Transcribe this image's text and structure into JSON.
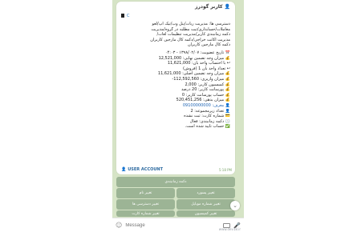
{
  "bubble": {
    "title": "کاربر گودرز",
    "phone_code": "C",
    "lines": [
      "دسترسی ها: مدیریت ربات/پنل وب/تیک آپ/لغو",
      "معاملات/حسابداری/ثبت مطلبه در گروه/مدیریت",
      "دکمه زمانبندی کاربر/مدیریت تنظیمات لغات/",
      "مدیریت اکانت خراجی/دکمه کال مارجین کاربران",
      "دکمه کال مارجین کاربران",
      "تاریخ عضویت: ۱۳۹۸/۰۲/۰۷ - ۰۴:۰۳",
      "میزان وجه تضمین نهایی: 12,521,000",
      "با احتساب واحد بان: 11,621,000",
      "تعداد واحد بان 1 (فروش)",
      "میزان وجه تضمین اصلی: 11,621,000",
      "میزان واریزی: 112,592,560-",
      "کمیسیون کاربر: 2,000",
      "پورسانت کاربر: 20 درصد",
      "حساب پورسانت کاربر: 0",
      "میزان بدهی: 520,451,256",
      "معرف: 09100000000",
      "تعداد زیرمجموعه: 2",
      "شماره کارت: ثبت نشده",
      "دکمه زمانبندی: فعال",
      "حساب تایید شده است."
    ],
    "line_icons": [
      "",
      "",
      "",
      "",
      "",
      "📅",
      "💰",
      "↩",
      "↩",
      "💰",
      "💰",
      "💰",
      "💰",
      "💰",
      "💰",
      "👤",
      "👤",
      "💳",
      "🕒",
      "✅"
    ],
    "account_label": "USER ACCOUNT",
    "time": "5:18 PM"
  },
  "keyboard": {
    "row1": [
      "دکمه زمانبندی"
    ],
    "row2": [
      "تغییر پسورد",
      "تغییر نام"
    ],
    "row3": [
      "تغییر شماره موبایل",
      "تغییر دسترسی ها"
    ],
    "row4": [
      "تغییر کمیسیون",
      "تغییر شماره کارت"
    ]
  },
  "input": {
    "placeholder": "Message"
  },
  "watermark": "www.dev18.ir"
}
